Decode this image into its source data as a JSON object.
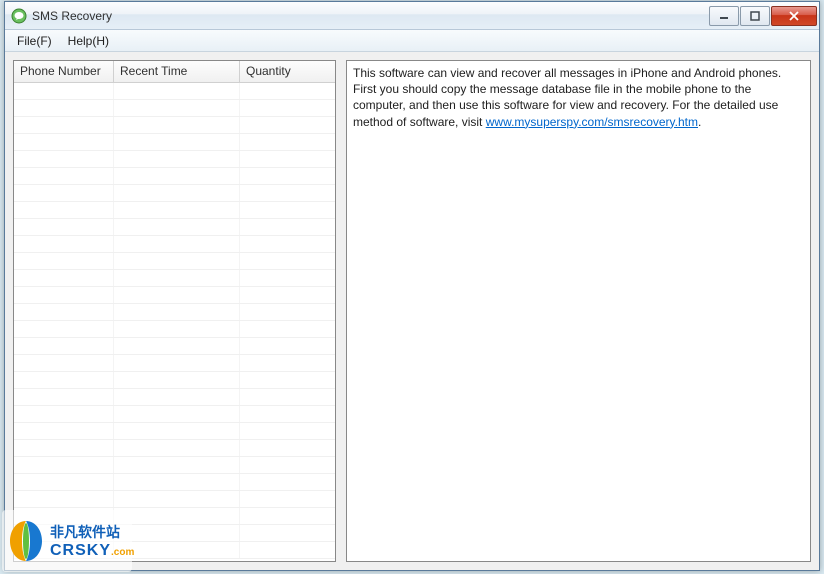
{
  "window": {
    "title": "SMS Recovery"
  },
  "menu": {
    "file": "File(F)",
    "help": "Help(H)"
  },
  "table": {
    "headers": {
      "phone": "Phone Number",
      "time": "Recent Time",
      "quantity": "Quantity"
    },
    "rows": []
  },
  "info": {
    "text_before_link": "This software can view and recover all messages in iPhone and Android phones. First you should copy the message database file in the mobile phone to the computer, and then use this software for view and recovery. For the detailed use method of software, visit ",
    "link_text": "www.mysuperspy.com/smsrecovery.htm",
    "text_after_link": "."
  },
  "watermark": {
    "cn": "非凡软件站",
    "en": "CRSKY",
    "suffix": ".com"
  }
}
